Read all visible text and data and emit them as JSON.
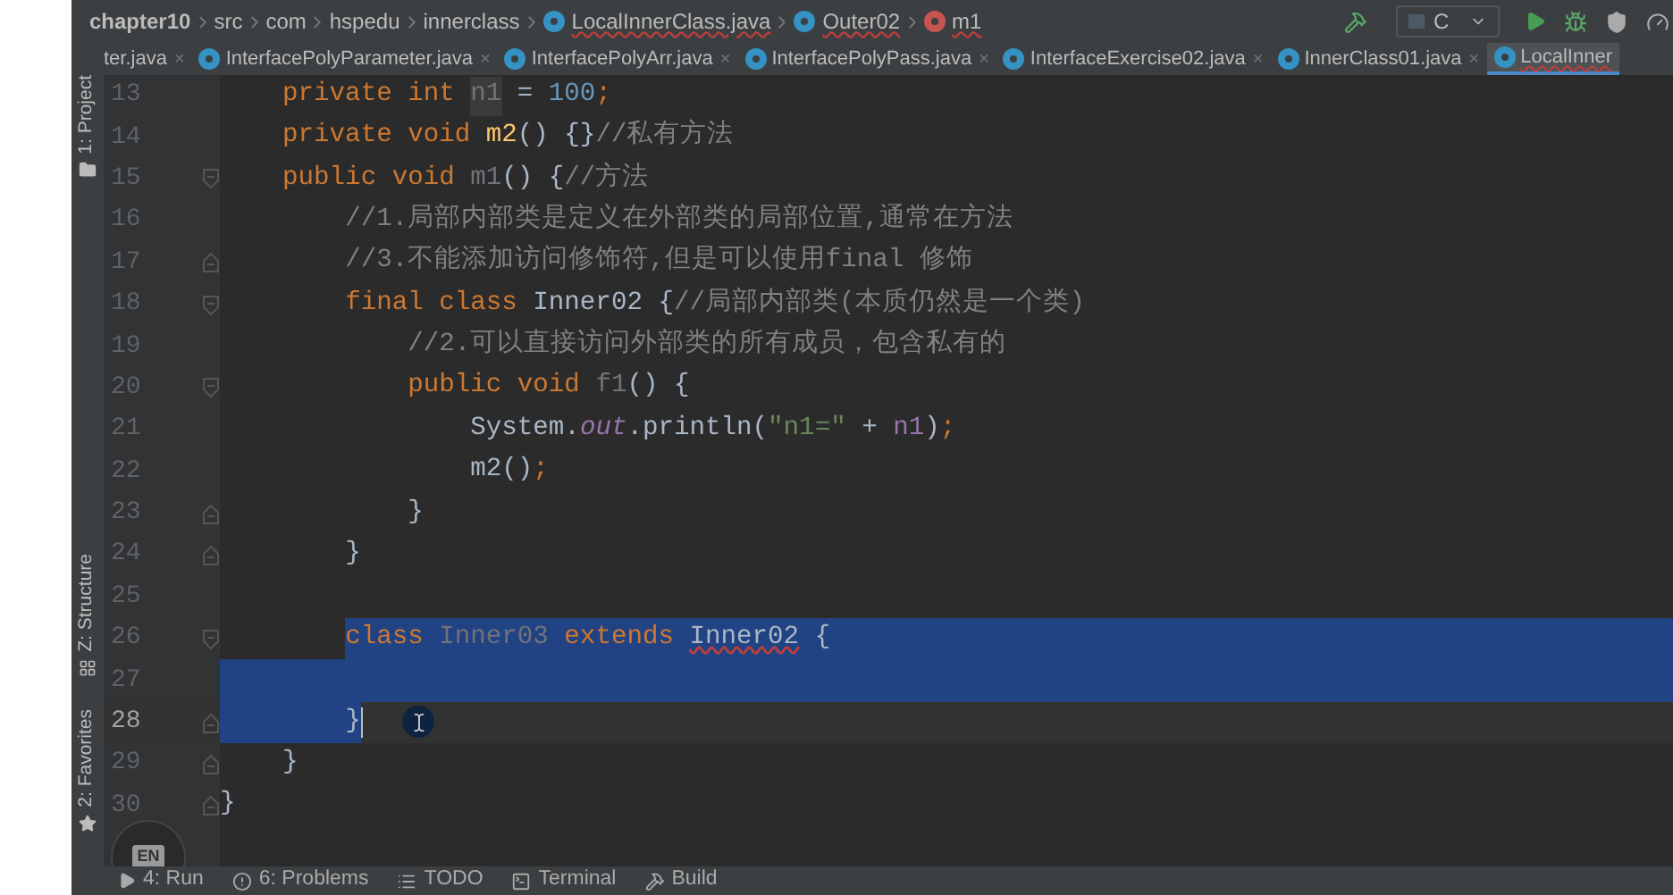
{
  "breadcrumbs": [
    {
      "text": "chapter10",
      "kind": "project"
    },
    {
      "text": "src",
      "kind": "folder"
    },
    {
      "text": "com",
      "kind": "folder"
    },
    {
      "text": "hspedu",
      "kind": "folder"
    },
    {
      "text": "innerclass",
      "kind": "folder"
    },
    {
      "text": "LocalInnerClass.java",
      "kind": "class"
    },
    {
      "text": "Outer02",
      "kind": "class"
    },
    {
      "text": "m1",
      "kind": "method"
    }
  ],
  "run_config": {
    "label": "C"
  },
  "tabs": [
    {
      "label": "ter.java",
      "selected": false,
      "close": "×",
      "kind": "cut"
    },
    {
      "label": "InterfacePolyParameter.java",
      "selected": false,
      "close": "×",
      "kind": "class"
    },
    {
      "label": "InterfacePolyArr.java",
      "selected": false,
      "close": "×",
      "kind": "class"
    },
    {
      "label": "InterfacePolyPass.java",
      "selected": false,
      "close": "×",
      "kind": "class"
    },
    {
      "label": "InterfaceExercise02.java",
      "selected": false,
      "close": "×",
      "kind": "class"
    },
    {
      "label": "InnerClass01.java",
      "selected": false,
      "close": "×",
      "kind": "class"
    },
    {
      "label": "LocalInner",
      "selected": true,
      "kind": "class"
    }
  ],
  "side_tools": [
    {
      "label": "1: Project",
      "kind": "project"
    },
    {
      "label": "Z: Structure",
      "kind": "structure"
    },
    {
      "label": "2: Favorites",
      "kind": "favorites"
    }
  ],
  "lines": [
    {
      "number": "13",
      "kind": "plain",
      "tokens": [
        {
          "kind": "kw",
          "text": "    private int "
        },
        {
          "kind": "unused-hl",
          "text": "n1"
        },
        {
          "kind": "plain",
          "text": " = "
        },
        {
          "kind": "num",
          "text": "100"
        },
        {
          "kind": "kw",
          "text": ";"
        }
      ]
    },
    {
      "number": "14",
      "kind": "plain",
      "tokens": [
        {
          "kind": "kw",
          "text": "    private void "
        },
        {
          "kind": "decl",
          "text": "m2"
        },
        {
          "kind": "plain",
          "text": "() {}"
        },
        {
          "kind": "comment",
          "text": "//私有方法"
        }
      ]
    },
    {
      "number": "15",
      "kind": "fold-start",
      "tokens": [
        {
          "kind": "kw",
          "text": "    public void "
        },
        {
          "kind": "unused",
          "text": "m1"
        },
        {
          "kind": "plain",
          "text": "() {"
        },
        {
          "kind": "comment",
          "text": "//方法"
        }
      ]
    },
    {
      "number": "16",
      "kind": "plain",
      "tokens": [
        {
          "kind": "comment",
          "text": "        //1.局部内部类是定义在外部类的局部位置,通常在方法"
        }
      ]
    },
    {
      "number": "17",
      "kind": "fold-end",
      "tokens": [
        {
          "kind": "comment",
          "text": "        //3.不能添加访问修饰符,但是可以使用final 修饰"
        }
      ]
    },
    {
      "number": "18",
      "kind": "fold-start",
      "tokens": [
        {
          "kind": "kw",
          "text": "        final class "
        },
        {
          "kind": "plain",
          "text": "Inner02 {"
        },
        {
          "kind": "comment",
          "text": "//局部内部类(本质仍然是一个类)"
        }
      ]
    },
    {
      "number": "19",
      "kind": "plain",
      "tokens": [
        {
          "kind": "comment",
          "text": "            //2.可以直接访问外部类的所有成员，包含私有的"
        }
      ]
    },
    {
      "number": "20",
      "kind": "fold-start",
      "tokens": [
        {
          "kind": "kw",
          "text": "            public void "
        },
        {
          "kind": "unused",
          "text": "f1"
        },
        {
          "kind": "plain",
          "text": "() {"
        }
      ]
    },
    {
      "number": "21",
      "kind": "plain",
      "tokens": [
        {
          "kind": "plain",
          "text": "                System."
        },
        {
          "kind": "static",
          "text": "out"
        },
        {
          "kind": "plain",
          "text": ".println("
        },
        {
          "kind": "str",
          "text": "\"n1=\""
        },
        {
          "kind": "plain",
          "text": " + "
        },
        {
          "kind": "field",
          "text": "n1"
        },
        {
          "kind": "plain",
          "text": ")"
        },
        {
          "kind": "kw",
          "text": ";"
        }
      ]
    },
    {
      "number": "22",
      "kind": "plain",
      "tokens": [
        {
          "kind": "plain",
          "text": "                m2()"
        },
        {
          "kind": "kw",
          "text": ";"
        }
      ]
    },
    {
      "number": "23",
      "kind": "fold-end",
      "tokens": [
        {
          "kind": "plain",
          "text": "            }"
        }
      ]
    },
    {
      "number": "24",
      "kind": "fold-end",
      "tokens": [
        {
          "kind": "plain",
          "text": "        }"
        }
      ]
    },
    {
      "number": "25",
      "kind": "plain"
    },
    {
      "number": "26",
      "kind": "fold-start",
      "selected": true,
      "tokens": [
        {
          "kind": "kw",
          "text": "        class "
        },
        {
          "kind": "unused",
          "text": "Inner03"
        },
        {
          "kind": "kw",
          "text": " extends "
        },
        {
          "kind": "error-ref",
          "text": "Inner02"
        },
        {
          "kind": "plain",
          "text": " {"
        }
      ]
    },
    {
      "number": "27",
      "kind": "plain",
      "selected": true
    },
    {
      "number": "28",
      "kind": "fold-end",
      "selected": true,
      "current": true,
      "tokens": [
        {
          "kind": "plain",
          "text": "        }"
        }
      ]
    },
    {
      "number": "29",
      "kind": "fold-end",
      "tokens": [
        {
          "kind": "plain",
          "text": "    }"
        }
      ]
    },
    {
      "number": "30",
      "kind": "fold-end",
      "tokens": [
        {
          "kind": "plain",
          "text": "}"
        }
      ]
    }
  ],
  "ime_badge": {
    "label": "EN"
  },
  "bottom_tools": [
    {
      "label": "4: Run",
      "kind": "run"
    },
    {
      "label": "6: Problems",
      "kind": "problems"
    },
    {
      "label": "TODO",
      "kind": "todo"
    },
    {
      "label": "Terminal",
      "kind": "terminal"
    },
    {
      "label": "Build",
      "kind": "build"
    }
  ]
}
